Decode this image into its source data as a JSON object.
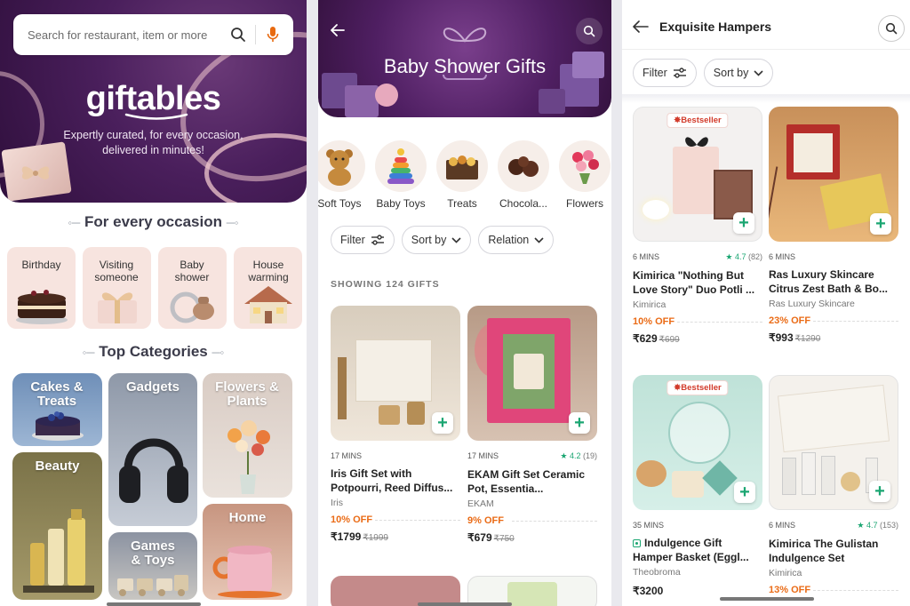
{
  "screen1": {
    "search": {
      "placeholder": "Search for restaurant, item or more"
    },
    "brand": "giftables",
    "tagline_line1": "Expertly curated, for every occasion,",
    "tagline_line2": "delivered in minutes!",
    "occasion_title": "For every occasion",
    "occasions": [
      {
        "label": "Birthday"
      },
      {
        "label": "Visiting someone"
      },
      {
        "label": "Baby shower"
      },
      {
        "label": "House warming"
      }
    ],
    "categories_title": "Top Categories",
    "categories": [
      {
        "label": "Cakes & Treats"
      },
      {
        "label": "Gadgets"
      },
      {
        "label": "Flowers & Plants"
      },
      {
        "label": "Beauty"
      },
      {
        "label": "Games & Toys"
      },
      {
        "label": "Home"
      }
    ]
  },
  "screen2": {
    "title": "Baby Shower Gifts",
    "subcategories": [
      {
        "label": "Soft Toys"
      },
      {
        "label": "Baby Toys"
      },
      {
        "label": "Treats"
      },
      {
        "label": "Chocola..."
      },
      {
        "label": "Flowers"
      }
    ],
    "filters": {
      "filter": "Filter",
      "sort": "Sort by",
      "relation": "Relation"
    },
    "showing": "SHOWING 124 GIFTS",
    "products": [
      {
        "time": "17 MINS",
        "rating": "",
        "rating_count": "",
        "name": "Iris Gift Set with Potpourri, Reed Diffus...",
        "brand": "Iris",
        "offer": "10% OFF",
        "price": "₹1799",
        "old_price": "₹1999"
      },
      {
        "time": "17 MINS",
        "rating": "★ 4.2",
        "rating_count": "(19)",
        "name": "EKAM Gift Set Ceramic Pot, Essentia...",
        "brand": "EKAM",
        "offer": "9% OFF",
        "price": "₹679",
        "old_price": "₹750"
      }
    ]
  },
  "screen3": {
    "title": "Exquisite Hampers",
    "filters": {
      "filter": "Filter",
      "sort": "Sort by"
    },
    "badge": "Bestseller",
    "products": [
      {
        "time": "6 MINS",
        "rating": "★ 4.7",
        "rating_count": "(82)",
        "name": "Kimirica \"Nothing But Love Story\" Duo Potli ...",
        "brand": "Kimirica",
        "offer": "10% OFF",
        "price": "₹629",
        "old_price": "₹699"
      },
      {
        "time": "6 MINS",
        "rating": "",
        "rating_count": "",
        "name": "Ras Luxury Skincare Citrus Zest Bath & Bo...",
        "brand": "Ras Luxury Skincare",
        "offer": "23% OFF",
        "price": "₹993",
        "old_price": "₹1290"
      },
      {
        "time": "35 MINS",
        "rating": "",
        "rating_count": "",
        "name": "Indulgence Gift Hamper Basket (Eggl...",
        "brand": "Theobroma",
        "offer": "",
        "price": "₹3200",
        "old_price": ""
      },
      {
        "time": "6 MINS",
        "rating": "★ 4.7",
        "rating_count": "(153)",
        "name": "Kimirica The Gulistan Indulgence Set",
        "brand": "Kimirica",
        "offer": "13% OFF",
        "price": "",
        "old_price": ""
      }
    ]
  },
  "colors": {
    "brand_purple": "#4a1f5c",
    "add_green": "#1ba672",
    "offer_orange": "#ea6b16",
    "mic_orange": "#e86a10"
  }
}
